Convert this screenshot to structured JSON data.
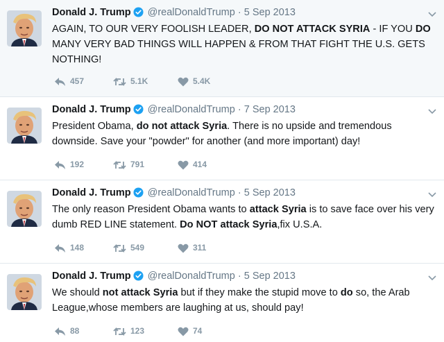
{
  "tweets": [
    {
      "name": "Donald J. Trump",
      "handle": "@realDonaldTrump",
      "sep": "·",
      "time": "5 Sep 2013",
      "segments": [
        {
          "t": "AGAIN, TO OUR VERY FOOLISH LEADER, "
        },
        {
          "t": "DO NOT ATTACK SYRIA",
          "b": true
        },
        {
          "t": " - IF YOU "
        },
        {
          "t": "DO",
          "b": true
        },
        {
          "t": " MANY VERY BAD THINGS WILL HAPPEN & FROM THAT FIGHT THE U.S. GETS NOTHING!"
        }
      ],
      "replies": "457",
      "retweets": "5.1K",
      "likes": "5.4K"
    },
    {
      "name": "Donald J. Trump",
      "handle": "@realDonaldTrump",
      "sep": "·",
      "time": "7 Sep 2013",
      "segments": [
        {
          "t": "President Obama, "
        },
        {
          "t": "do not attack Syria",
          "b": true
        },
        {
          "t": ". There is no upside and tremendous downside. Save your \"powder\" for another (and more important) day!"
        }
      ],
      "replies": "192",
      "retweets": "791",
      "likes": "414"
    },
    {
      "name": "Donald J. Trump",
      "handle": "@realDonaldTrump",
      "sep": "·",
      "time": "5 Sep 2013",
      "segments": [
        {
          "t": "The only reason President Obama wants to "
        },
        {
          "t": "attack Syria",
          "b": true
        },
        {
          "t": " is to save face over his very dumb RED LINE statement. "
        },
        {
          "t": "Do NOT attack Syria",
          "b": true
        },
        {
          "t": ",fix U.S.A."
        }
      ],
      "replies": "148",
      "retweets": "549",
      "likes": "311"
    },
    {
      "name": "Donald J. Trump",
      "handle": "@realDonaldTrump",
      "sep": "·",
      "time": "5 Sep 2013",
      "segments": [
        {
          "t": "We should "
        },
        {
          "t": "not attack Syria",
          "b": true
        },
        {
          "t": " but if they make the stupid move to "
        },
        {
          "t": "do",
          "b": true
        },
        {
          "t": " so, the Arab League,whose members are laughing at us, should pay!"
        }
      ],
      "replies": "88",
      "retweets": "123",
      "likes": "74"
    }
  ],
  "colors": {
    "verified": "#1da1f2",
    "meta": "#657786",
    "action": "#8899a6",
    "highlight_bg": "#f5f8fa",
    "border": "#e1e8ed"
  },
  "icons": {
    "avatar": "avatar",
    "verified": "verified-badge-icon",
    "caret": "chevron-down-icon",
    "reply": "reply-icon",
    "retweet": "retweet-icon",
    "like": "heart-icon"
  }
}
